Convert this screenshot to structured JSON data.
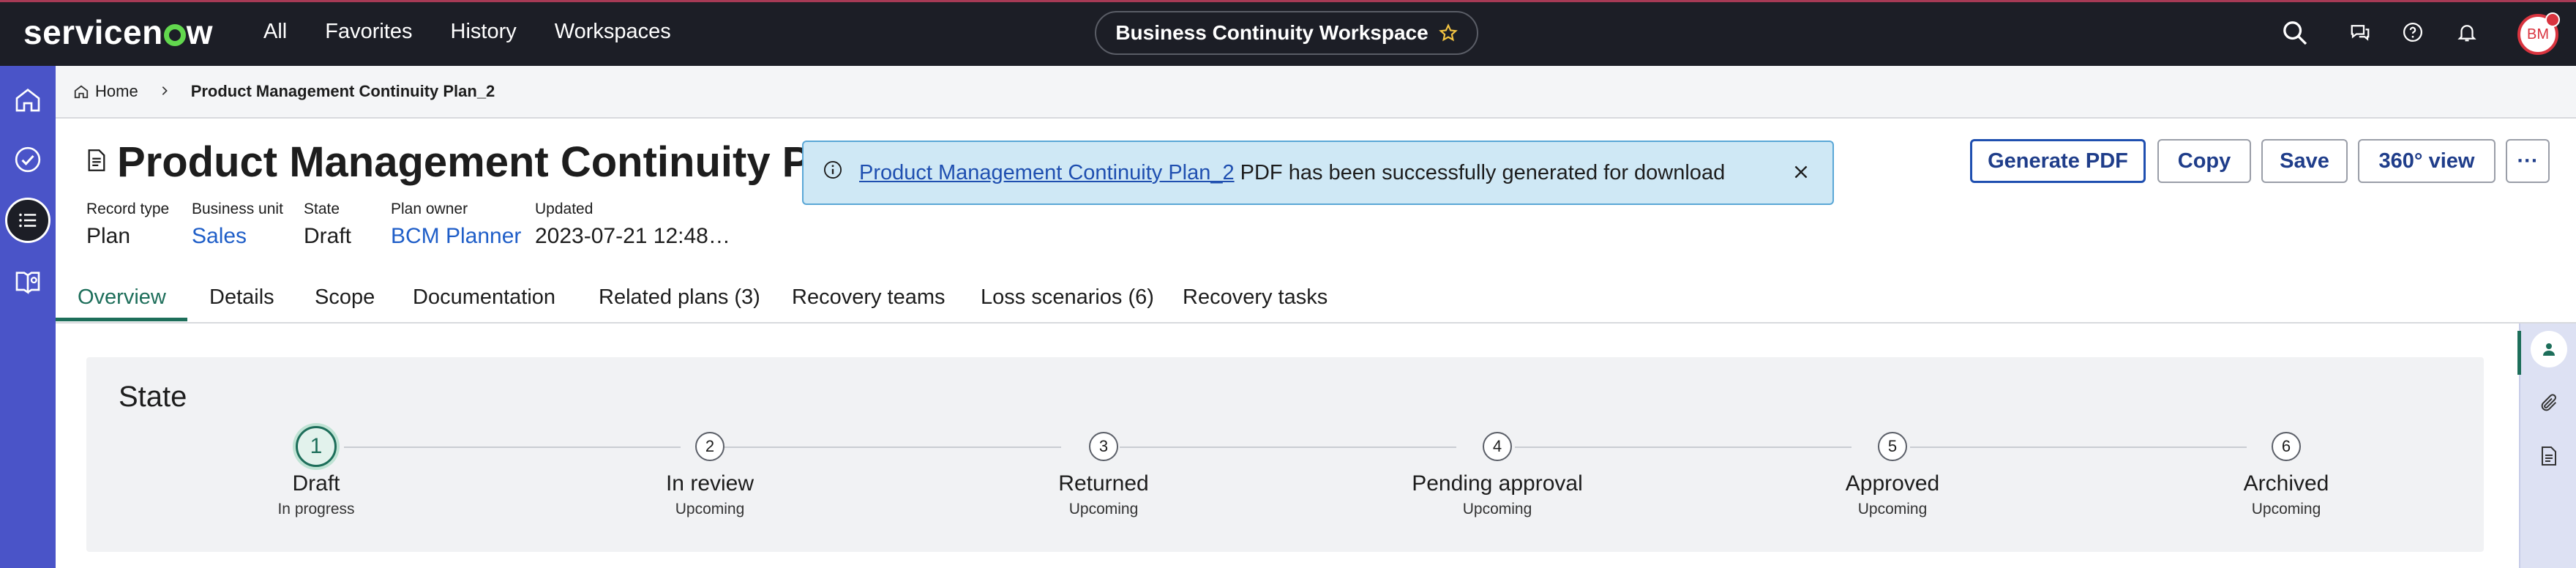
{
  "brand": {
    "logo_text_a": "servicen",
    "logo_text_b": "w"
  },
  "topnav": {
    "items": [
      "All",
      "Favorites",
      "History",
      "Workspaces"
    ]
  },
  "workspace_pill": {
    "label": "Business Continuity Workspace",
    "star_icon": "star-outline-icon"
  },
  "top_icons": [
    "search-icon",
    "chat-icon",
    "help-icon",
    "bell-icon"
  ],
  "user": {
    "initials": "BM"
  },
  "rail": {
    "items": [
      "home-icon",
      "check-circle-icon",
      "list-icon",
      "map-book-icon"
    ]
  },
  "breadcrumb": {
    "home": "Home",
    "current": "Product Management Continuity Plan_2"
  },
  "record": {
    "title": "Product Management Continuity Plan_",
    "fields": [
      {
        "label": "Record type",
        "value": "Plan",
        "link": false
      },
      {
        "label": "Business unit",
        "value": "Sales",
        "link": true
      },
      {
        "label": "State",
        "value": "Draft",
        "link": false
      },
      {
        "label": "Plan owner",
        "value": "BCM Planner",
        "link": true
      },
      {
        "label": "Updated",
        "value": "2023-07-21 12:48…",
        "link": false
      }
    ]
  },
  "toast": {
    "link_text": "Product Management Continuity Plan_2",
    "message": "PDF has been successfully generated for download"
  },
  "actions": {
    "generate_pdf": "Generate PDF",
    "copy": "Copy",
    "save": "Save",
    "view_360": "360° view",
    "more": "···"
  },
  "tabs": [
    "Overview",
    "Details",
    "Scope",
    "Documentation",
    "Related plans (3)",
    "Recovery teams",
    "Loss scenarios (6)",
    "Recovery tasks"
  ],
  "state": {
    "title": "State",
    "steps": [
      {
        "num": "1",
        "name": "Draft",
        "status": "In progress"
      },
      {
        "num": "2",
        "name": "In review",
        "status": "Upcoming"
      },
      {
        "num": "3",
        "name": "Returned",
        "status": "Upcoming"
      },
      {
        "num": "4",
        "name": "Pending approval",
        "status": "Upcoming"
      },
      {
        "num": "5",
        "name": "Approved",
        "status": "Upcoming"
      },
      {
        "num": "6",
        "name": "Archived",
        "status": "Upcoming"
      }
    ]
  },
  "colors": {
    "nav_bg": "#1c1e26",
    "rail_bg": "#4a54c8",
    "accent_green": "#1d6e5a",
    "link_blue": "#1f5ec8",
    "toast_bg": "#cfe8f5"
  }
}
